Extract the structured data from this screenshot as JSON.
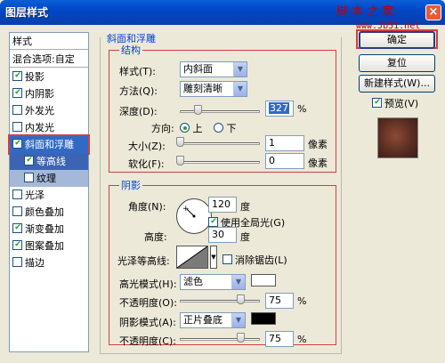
{
  "window": {
    "title": "图层样式",
    "watermark": "脚 本 之 家",
    "watermark_url": "www.Jb51.net",
    "close_glyph": "×"
  },
  "style_list": {
    "header": "样式",
    "blend_options": "混合选项:自定",
    "items": [
      {
        "label": "投影",
        "checked": true
      },
      {
        "label": "内阴影",
        "checked": true
      },
      {
        "label": "外发光",
        "checked": false
      },
      {
        "label": "内发光",
        "checked": false
      },
      {
        "label": "斜面和浮雕",
        "checked": true,
        "selected": true
      },
      {
        "label": "等高线",
        "checked": true,
        "sub": true
      },
      {
        "label": "纹理",
        "checked": false,
        "sub": true
      },
      {
        "label": "光泽",
        "checked": false
      },
      {
        "label": "颜色叠加",
        "checked": false
      },
      {
        "label": "渐变叠加",
        "checked": true
      },
      {
        "label": "图案叠加",
        "checked": true
      },
      {
        "label": "描边",
        "checked": false
      }
    ]
  },
  "bevel": {
    "group_title": "斜面和浮雕",
    "structure": {
      "title": "结构",
      "style_label": "样式(T):",
      "style_value": "内斜面",
      "technique_label": "方法(Q):",
      "technique_value": "雕刻清晰",
      "depth_label": "深度(D):",
      "depth_value": "327",
      "depth_unit": "%",
      "depth_slider": 0.22,
      "direction_label": "方向:",
      "direction_up": "上",
      "direction_down": "下",
      "size_label": "大小(Z):",
      "size_value": "1",
      "size_unit": "像素",
      "size_slider": 0.0,
      "soften_label": "软化(F):",
      "soften_value": "0",
      "soften_unit": "像素",
      "soften_slider": 0.0
    },
    "shading": {
      "title": "阴影",
      "angle_label": "角度(N):",
      "angle_value": "120",
      "angle_unit": "度",
      "global_light_label": "使用全局光(G)",
      "altitude_label": "高度:",
      "altitude_value": "30",
      "altitude_unit": "度",
      "gloss_contour_label": "光泽等高线:",
      "antialias_label": "消除锯齿(L)",
      "highlight_mode_label": "高光模式(H):",
      "highlight_mode_value": "滤色",
      "highlight_color": "#ffffff",
      "highlight_opacity_label": "不透明度(O):",
      "highlight_opacity_value": "75",
      "highlight_opacity_unit": "%",
      "highlight_opacity_slider": 0.75,
      "shadow_mode_label": "阴影模式(A):",
      "shadow_mode_value": "正片叠底",
      "shadow_color": "#000000",
      "shadow_opacity_label": "不透明度(C):",
      "shadow_opacity_value": "75",
      "shadow_opacity_unit": "%",
      "shadow_opacity_slider": 0.75
    }
  },
  "buttons": {
    "ok": "确定",
    "reset": "复位",
    "new_style": "新建样式(W)...",
    "preview": "预览(V)"
  },
  "colors": {
    "accent": "#316ac5",
    "highlight_box": "#d04040",
    "group_title": "#0046d5"
  }
}
